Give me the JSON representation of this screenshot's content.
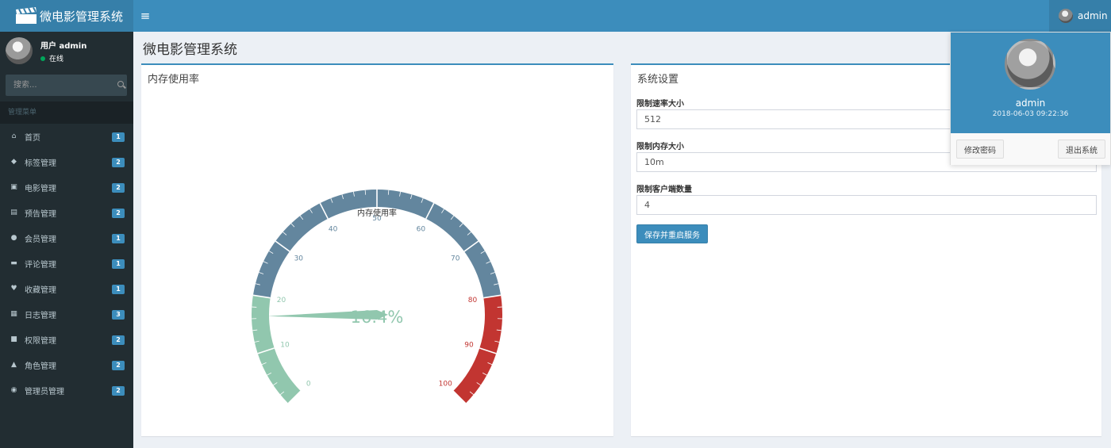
{
  "app": {
    "logo_text": "微电影管理系统"
  },
  "navbar": {
    "toggle_icon": "≡",
    "user_label": "admin"
  },
  "sidebar": {
    "user_name": "用户 admin",
    "user_status": "在线",
    "search_placeholder": "搜索...",
    "menu_header": "管理菜单",
    "items": [
      {
        "label": "首页",
        "icon": "home-icon",
        "glyph": "⌂",
        "badge": "1"
      },
      {
        "label": "标签管理",
        "icon": "tags-icon",
        "glyph": "◆",
        "badge": "2"
      },
      {
        "label": "电影管理",
        "icon": "file-video-icon",
        "glyph": "▣",
        "badge": "2"
      },
      {
        "label": "预告管理",
        "icon": "film-icon",
        "glyph": "▤",
        "badge": "2"
      },
      {
        "label": "会员管理",
        "icon": "users-icon",
        "glyph": "●",
        "badge": "1"
      },
      {
        "label": "评论管理",
        "icon": "comments-icon",
        "glyph": "▬",
        "badge": "1"
      },
      {
        "label": "收藏管理",
        "icon": "heart-icon",
        "glyph": "♥",
        "badge": "1"
      },
      {
        "label": "日志管理",
        "icon": "file-text-icon",
        "glyph": "▦",
        "badge": "3"
      },
      {
        "label": "权限管理",
        "icon": "lock-icon",
        "glyph": "■",
        "badge": "2"
      },
      {
        "label": "角色管理",
        "icon": "user-secret-icon",
        "glyph": "▲",
        "badge": "2"
      },
      {
        "label": "管理员管理",
        "icon": "user-circle-icon",
        "glyph": "◉",
        "badge": "2"
      }
    ]
  },
  "page": {
    "title": "微电影管理系统"
  },
  "memory_box": {
    "title": "内存使用率",
    "gauge": {
      "name": "内存使用率",
      "value_text": "16.4%",
      "value": 16.4,
      "min": 0,
      "max": 100,
      "ticks": [
        "0",
        "10",
        "20",
        "30",
        "40",
        "50",
        "60",
        "70",
        "80",
        "90",
        "100"
      ],
      "color_low": "#91c7ae",
      "color_mid": "#63869e",
      "color_high": "#c23531"
    }
  },
  "settings_box": {
    "title": "系统设置",
    "rate_label": "限制速率大小",
    "rate_value": "512",
    "memory_label": "限制内存大小",
    "memory_value": "10m",
    "clients_label": "限制客户端数量",
    "clients_value": "4",
    "submit_label": "保存并重启服务"
  },
  "user_dropdown": {
    "name": "admin",
    "time": "2018-06-03 09:22:36",
    "change_password_label": "修改密码",
    "logout_label": "退出系统"
  },
  "colors": {
    "primary": "#3c8dbc",
    "sidebar_bg": "#222d32"
  }
}
